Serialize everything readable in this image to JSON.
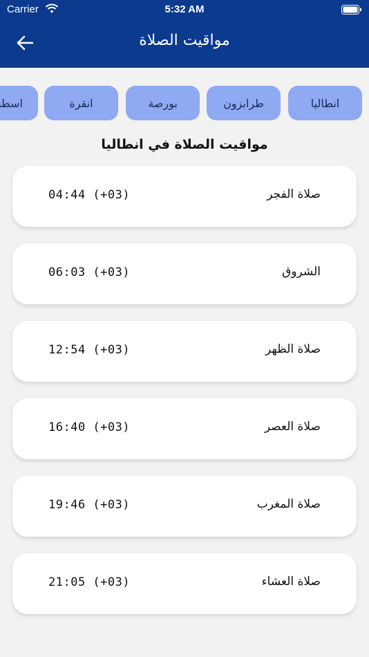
{
  "status_bar": {
    "carrier": "Carrier",
    "time": "5:32 AM"
  },
  "nav": {
    "title": "مواقيت الصلاة",
    "back_icon": "arrow-left-icon"
  },
  "cities": [
    {
      "label": "انطاليا"
    },
    {
      "label": "طرابزون"
    },
    {
      "label": "بورصة"
    },
    {
      "label": "انقرة"
    },
    {
      "label": "اسطنبول"
    }
  ],
  "section_title": "مواقيت الصلاة في انطاليا",
  "prayers": [
    {
      "name": "صلاة الفجر",
      "time": "04:44 (+03)"
    },
    {
      "name": "الشروق",
      "time": "06:03 (+03)"
    },
    {
      "name": "صلاة الظهر",
      "time": "12:54 (+03)"
    },
    {
      "name": "صلاة العصر",
      "time": "16:40 (+03)"
    },
    {
      "name": "صلاة المغرب",
      "time": "19:46 (+03)"
    },
    {
      "name": "صلاة العشاء",
      "time": "21:05 (+03)"
    }
  ],
  "colors": {
    "header": "#0c3a8f",
    "chip": "#8fa9f3",
    "background": "#f2f2f2"
  }
}
